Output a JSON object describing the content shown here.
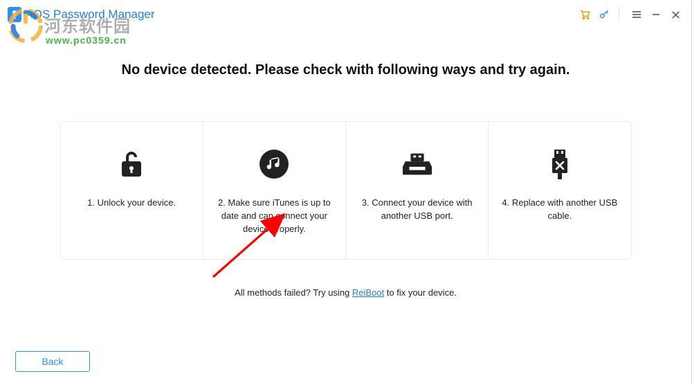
{
  "titlebar": {
    "title": "iOS Password Manager"
  },
  "watermark": {
    "line1": "河东软件园",
    "line2": "www.pc0359.cn"
  },
  "main": {
    "heading": "No device detected. Please check with following ways and try again.",
    "cards": [
      {
        "text": "1. Unlock your device."
      },
      {
        "text": "2. Make sure iTunes is up to date and can connect your device properly."
      },
      {
        "text": "3. Connect your device with another USB port."
      },
      {
        "text": "4. Replace with another USB cable."
      }
    ],
    "failed_prefix": "All methods failed? Try using ",
    "failed_link": "ReiBoot",
    "failed_suffix": " to fix your device."
  },
  "footer": {
    "back": "Back"
  }
}
